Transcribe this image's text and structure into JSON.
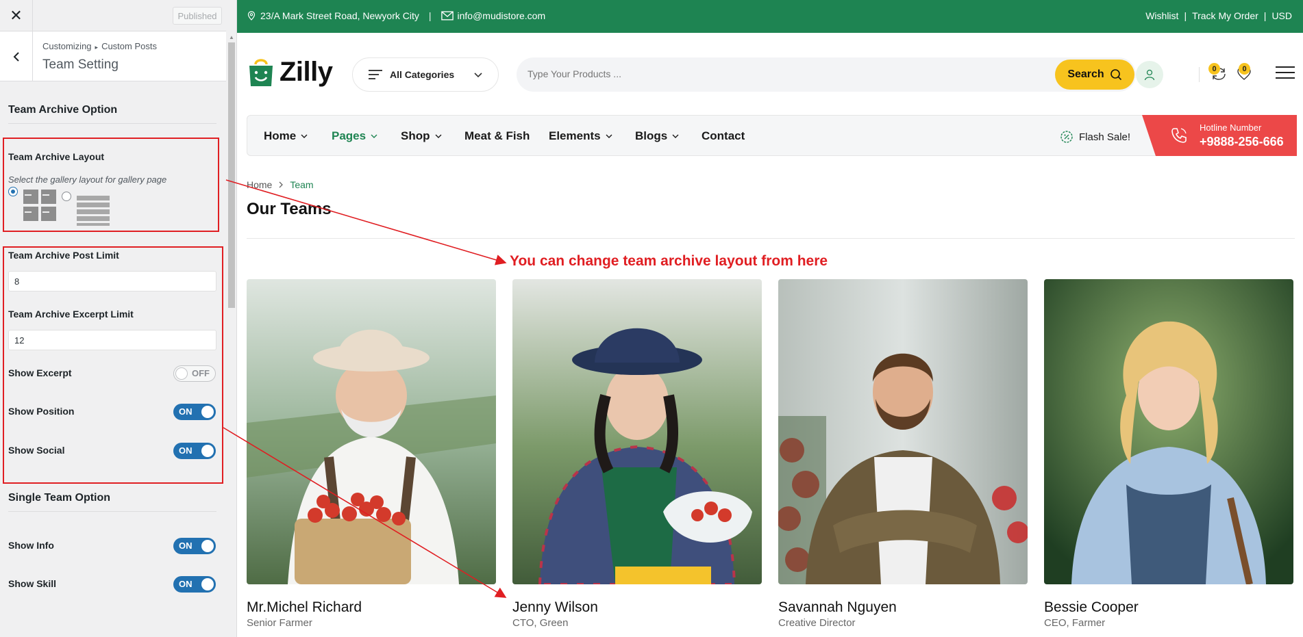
{
  "customizer": {
    "close_icon": "close-icon",
    "publish_label": "Published",
    "breadcrumb": [
      "Customizing",
      "Custom Posts"
    ],
    "title": "Team Setting",
    "archive_section_title": "Team Archive Option",
    "layout_label": "Team Archive Layout",
    "layout_desc": "Select the gallery layout for gallery page",
    "layout_options": [
      {
        "name": "grid",
        "selected": true
      },
      {
        "name": "list",
        "selected": false
      }
    ],
    "post_limit_label": "Team Archive Post Limit",
    "post_limit_value": "8",
    "excerpt_limit_label": "Team Archive Excerpt Limit",
    "excerpt_limit_value": "12",
    "show_excerpt_label": "Show Excerpt",
    "show_excerpt_state": "OFF",
    "show_position_label": "Show Position",
    "show_position_state": "ON",
    "show_social_label": "Show Social",
    "show_social_state": "ON",
    "single_section_title": "Single Team Option",
    "show_info_label": "Show Info",
    "show_info_state": "ON",
    "show_skill_label": "Show Skill",
    "show_skill_state": "ON"
  },
  "site": {
    "topbar": {
      "address": "23/A Mark Street Road, Newyork City",
      "email": "info@mudistore.com",
      "links": [
        "Wishlist",
        "Track My Order",
        "USD"
      ],
      "separator": "|"
    },
    "logo_text": "Zilly",
    "categories_label": "All Categories",
    "search_placeholder": "Type Your Products ...",
    "search_label": "Search",
    "compare_count": "0",
    "wishlist_count": "0",
    "nav": [
      {
        "label": "Home",
        "dropdown": true,
        "active": false
      },
      {
        "label": "Pages",
        "dropdown": true,
        "active": true
      },
      {
        "label": "Shop",
        "dropdown": true,
        "active": false
      },
      {
        "label": "Meat & Fish",
        "dropdown": false,
        "active": false
      },
      {
        "label": "Elements",
        "dropdown": true,
        "active": false
      },
      {
        "label": "Blogs",
        "dropdown": true,
        "active": false
      },
      {
        "label": "Contact",
        "dropdown": false,
        "active": false
      }
    ],
    "flash_label": "Flash Sale!",
    "hotline_label": "Hotline Number",
    "hotline_number": "+9888-256-666",
    "breadcrumb": [
      "Home",
      "Team"
    ],
    "page_title": "Our Teams",
    "annotation": "You can change team archive layout from here",
    "team": [
      {
        "name": "Mr.Michel Richard",
        "position": "Senior Farmer"
      },
      {
        "name": "Jenny Wilson",
        "position": "CTO, Green"
      },
      {
        "name": "Savannah Nguyen",
        "position": "Creative Director"
      },
      {
        "name": "Bessie Cooper",
        "position": "CEO, Farmer"
      }
    ],
    "colors": {
      "brand_green": "#1e8452",
      "accent_yellow": "#f7c31e",
      "hotline_red": "#ec4848",
      "annotation_red": "#e01e22",
      "wp_blue": "#2271b1"
    }
  }
}
